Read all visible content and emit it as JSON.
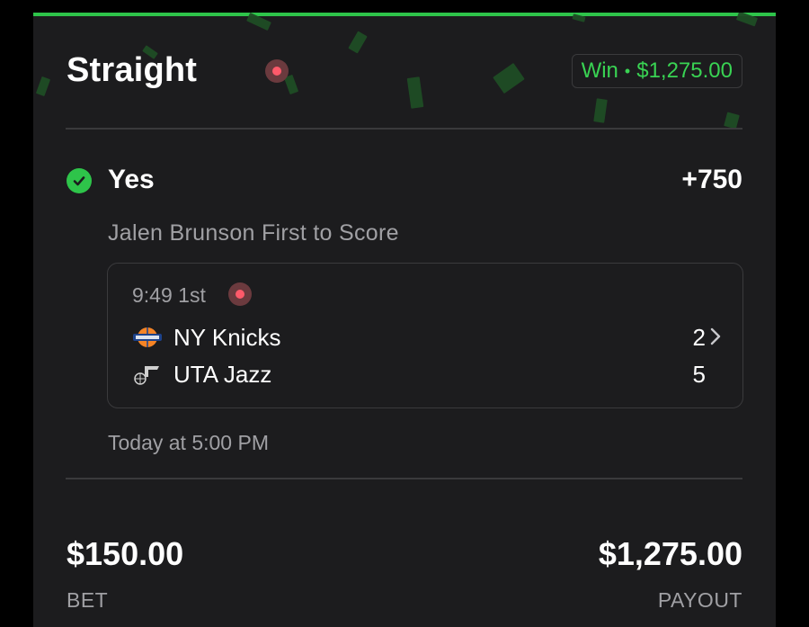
{
  "colors": {
    "accent_green": "#2ec44a",
    "win_text": "#39d353",
    "live_red": "#ff5a6a",
    "card_bg": "#1c1c1e",
    "muted_text": "#a0a0a4"
  },
  "header": {
    "title": "Straight",
    "live_icon": "live-record-icon",
    "badge": {
      "status": "Win",
      "separator": "•",
      "amount": "$1,275.00"
    }
  },
  "pick": {
    "status_icon": "check-circle-icon",
    "label": "Yes",
    "odds": "+750",
    "market": "Jalen Brunson First to Score"
  },
  "game": {
    "clock": "9:49 1st",
    "teams": [
      {
        "logo": "knicks-logo-icon",
        "name": "NY Knicks",
        "score": "2"
      },
      {
        "logo": "jazz-logo-icon",
        "name": "UTA Jazz",
        "score": "5"
      }
    ]
  },
  "date": "Today at 5:00 PM",
  "totals": {
    "bet_amount": "$150.00",
    "bet_label": "BET",
    "payout_amount": "$1,275.00",
    "payout_label": "PAYOUT"
  }
}
